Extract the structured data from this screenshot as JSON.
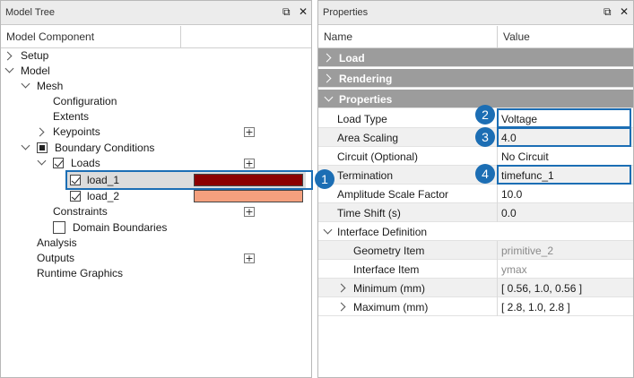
{
  "tree_panel": {
    "title": "Model Tree",
    "column_header": "Model Component",
    "items": [
      {
        "label": "Setup"
      },
      {
        "label": "Model"
      },
      {
        "label": "Mesh"
      },
      {
        "label": "Configuration"
      },
      {
        "label": "Extents"
      },
      {
        "label": "Keypoints"
      },
      {
        "label": "Boundary Conditions"
      },
      {
        "label": "Loads"
      },
      {
        "label": "load_1",
        "color": "#8b0000"
      },
      {
        "label": "load_2",
        "color": "#f4a07e"
      },
      {
        "label": "Constraints"
      },
      {
        "label": "Domain Boundaries"
      },
      {
        "label": "Analysis"
      },
      {
        "label": "Outputs"
      },
      {
        "label": "Runtime Graphics"
      }
    ],
    "plus_symbol": "+"
  },
  "props_panel": {
    "title": "Properties",
    "col_name": "Name",
    "col_value": "Value",
    "sections": {
      "load": "Load",
      "rendering": "Rendering",
      "properties": "Properties"
    },
    "rows": [
      {
        "name": "Load Type",
        "value": "Voltage"
      },
      {
        "name": "Area Scaling",
        "value": "4.0"
      },
      {
        "name": "Circuit (Optional)",
        "value": "No Circuit"
      },
      {
        "name": "Termination",
        "value": "timefunc_1"
      },
      {
        "name": "Amplitude Scale Factor",
        "value": "10.0"
      },
      {
        "name": "Time Shift (s)",
        "value": "0.0"
      },
      {
        "name": "Interface Definition",
        "value": ""
      },
      {
        "name": "Geometry Item",
        "value": "primitive_2"
      },
      {
        "name": "Interface Item",
        "value": "ymax"
      },
      {
        "name": "Minimum (mm)",
        "value": "[ 0.56, 1.0, 0.56 ]"
      },
      {
        "name": "Maximum (mm)",
        "value": "[ 2.8, 1.0, 2.8 ]"
      }
    ]
  },
  "window_controls": {
    "restore": "⧉",
    "close": "✕"
  },
  "callouts": [
    "1",
    "2",
    "3",
    "4"
  ],
  "colors": {
    "accent": "#1c6eb4",
    "section_bg": "#9c9c9c"
  }
}
